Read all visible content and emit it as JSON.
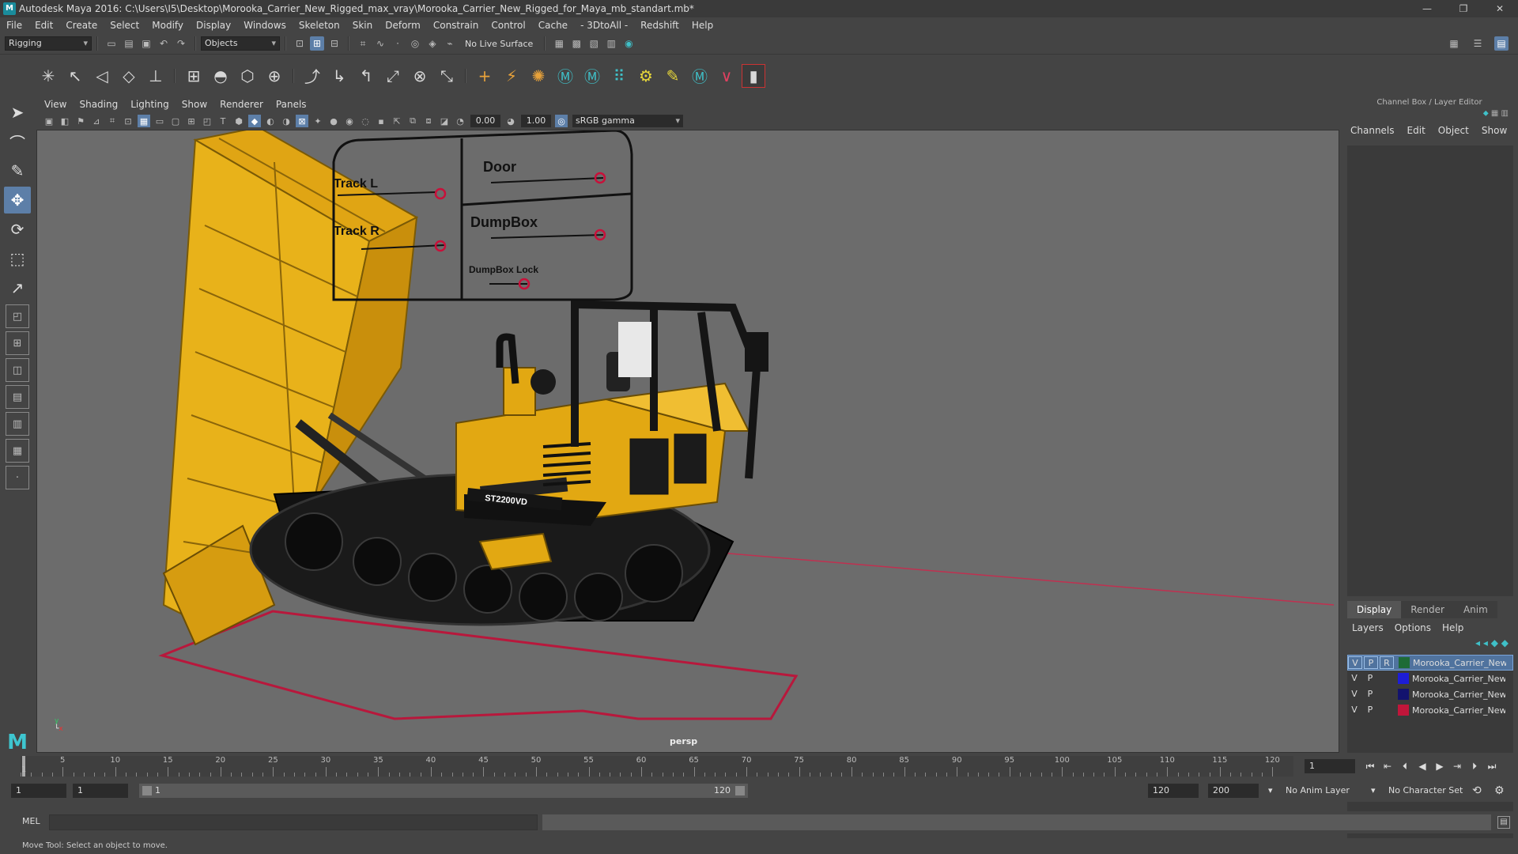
{
  "titlebar": {
    "title": "Autodesk Maya 2016: C:\\Users\\I5\\Desktop\\Morooka_Carrier_New_Rigged_max_vray\\Morooka_Carrier_New_Rigged_for_Maya_mb_standart.mb*",
    "minimize": "—",
    "restore": "❐",
    "close": "✕"
  },
  "menubar": [
    "File",
    "Edit",
    "Create",
    "Select",
    "Modify",
    "Display",
    "Windows",
    "Skeleton",
    "Skin",
    "Deform",
    "Constrain",
    "Control",
    "Cache",
    "- 3DtoAll -",
    "Redshift",
    "Help"
  ],
  "statusline": {
    "menuset": "Rigging",
    "selection_mode": "Objects",
    "live_surface": "No Live Surface"
  },
  "panel": {
    "menu": [
      "View",
      "Shading",
      "Lighting",
      "Show",
      "Renderer",
      "Panels"
    ],
    "exposure": "0.00",
    "gamma": "1.00",
    "color_space": "sRGB gamma",
    "camera": "persp"
  },
  "rig_panel": {
    "labels": [
      "Track L",
      "Track R",
      "Door",
      "DumpBox",
      "DumpBox Lock"
    ],
    "model_badge": "ST2200VD"
  },
  "channelbox": {
    "title": "Channel Box / Layer Editor",
    "menu": [
      "Channels",
      "Edit",
      "Object",
      "Show"
    ]
  },
  "layer_editor": {
    "tabs": [
      "Display",
      "Render",
      "Anim"
    ],
    "menu": [
      "Layers",
      "Options",
      "Help"
    ],
    "layers": [
      {
        "v": "V",
        "p": "P",
        "r": "R",
        "color": "#1e6b36",
        "name": "Morooka_Carrier_New"
      },
      {
        "v": "V",
        "p": "P",
        "r": "",
        "color": "#1d1dd6",
        "name": "Morooka_Carrier_New"
      },
      {
        "v": "V",
        "p": "P",
        "r": "",
        "color": "#13136e",
        "name": "Morooka_Carrier_New"
      },
      {
        "v": "V",
        "p": "P",
        "r": "",
        "color": "#c0163a",
        "name": "Morooka_Carrier_New"
      }
    ]
  },
  "timeslider": {
    "ticks": [
      "5",
      "10",
      "15",
      "20",
      "25",
      "30",
      "35",
      "40",
      "45",
      "50",
      "55",
      "60",
      "65",
      "70",
      "75",
      "80",
      "85",
      "90",
      "95",
      "100",
      "105",
      "110",
      "115",
      "120"
    ],
    "first": "1",
    "current_frame": "1"
  },
  "rangeslider": {
    "start": "1",
    "playback_start": "1",
    "range_start": "1",
    "range_end": "120",
    "playback_end": "120",
    "end": "200",
    "anim_layer": "No Anim Layer",
    "character_set": "No Character Set"
  },
  "cmdline": {
    "label": "MEL"
  },
  "helpline": "Move Tool: Select an object to move."
}
